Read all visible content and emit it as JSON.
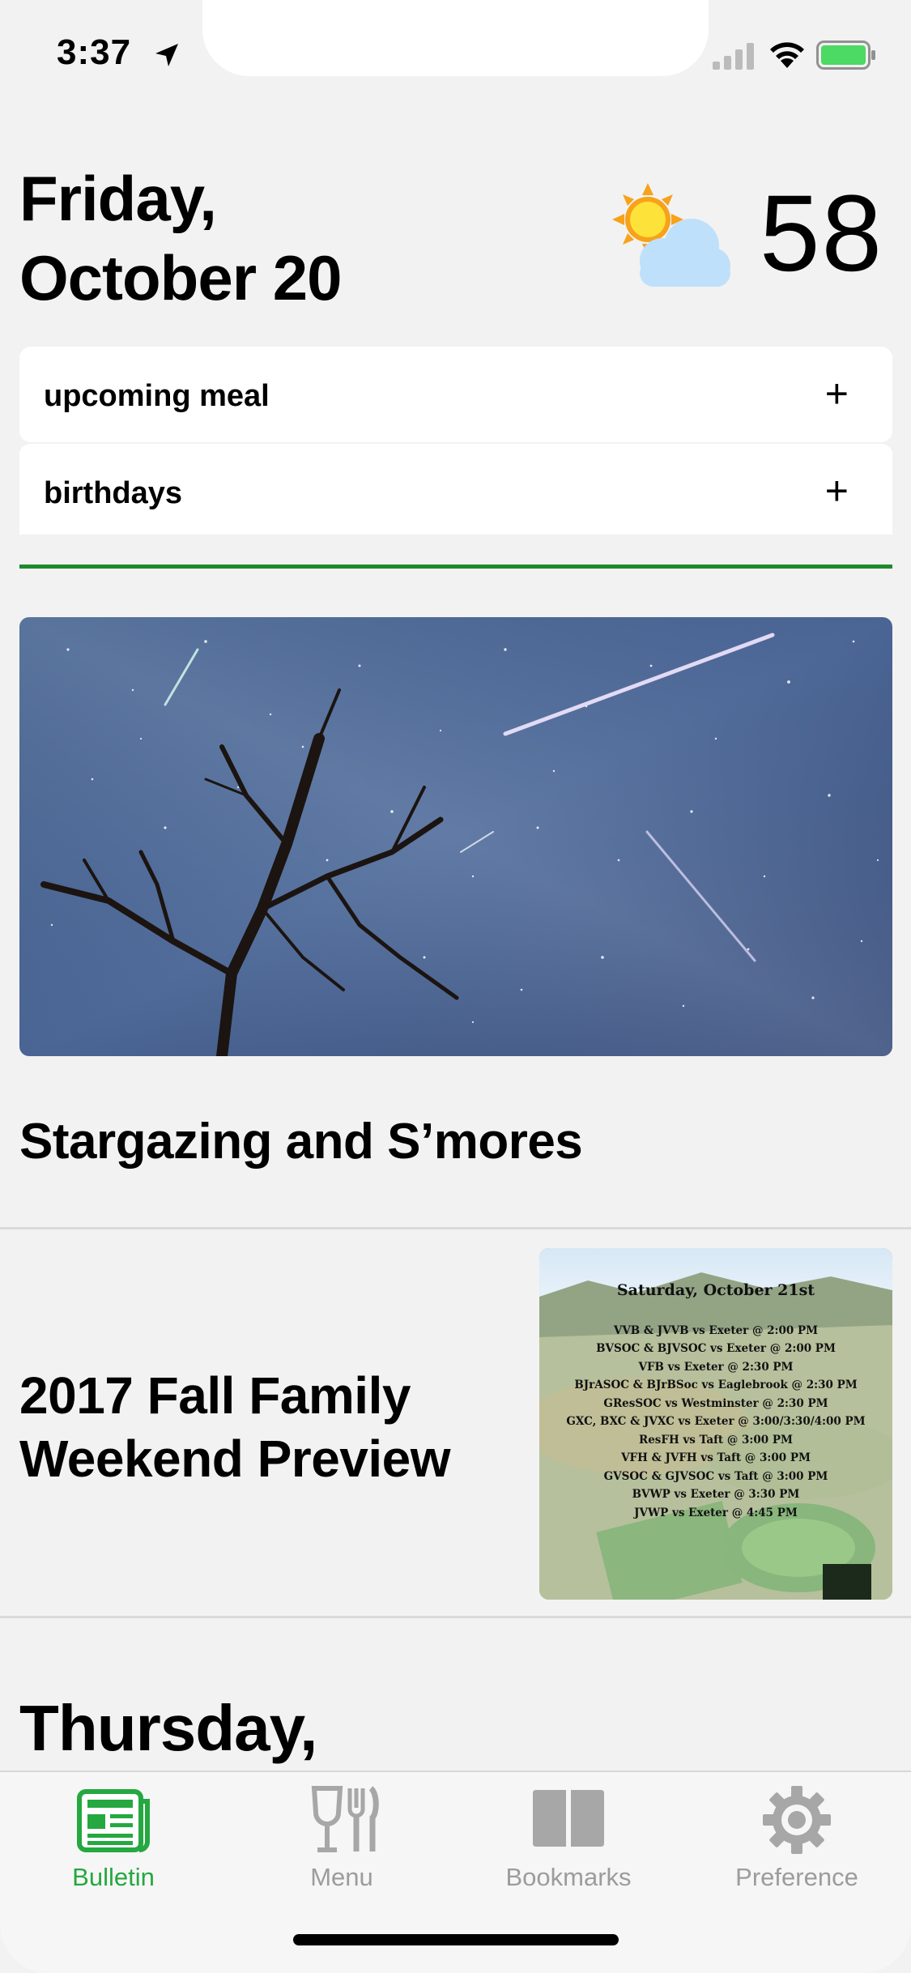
{
  "status_bar": {
    "time": "3:37",
    "battery_color": "#4cd964"
  },
  "header": {
    "date_line1": "Friday,",
    "date_line2": "October 20",
    "weather_icon": "partly-sunny-icon",
    "temperature": "58"
  },
  "accordion": [
    {
      "label": "upcoming meal",
      "toggle": "+"
    },
    {
      "label": "birthdays",
      "toggle": "+"
    }
  ],
  "accent_color": "#1d8a2b",
  "stories": [
    {
      "title": "Stargazing and S’mores",
      "image": "meteor-shower-night-sky-photo"
    },
    {
      "title_line1": "2017 Fall Family",
      "title_line2": "Weekend Preview",
      "image": "campus-aerial-schedule-photo"
    }
  ],
  "schedule_image": {
    "heading": "Saturday, October 21st",
    "lines": [
      "VVB & JVVB  vs Exeter @ 2:00 PM",
      "BVSOC & BJVSOC vs Exeter @ 2:00 PM",
      "VFB vs Exeter @ 2:30 PM",
      "BJrASOC & BJrBSoc vs Eaglebrook @ 2:30 PM",
      "GResSOC vs  Westminster @ 2:30 PM",
      "GXC, BXC & JVXC vs Exeter @ 3:00/3:30/4:00 PM",
      "ResFH vs Taft @ 3:00 PM",
      "VFH & JVFH vs Taft @ 3:00 PM",
      "GVSOC & GJVSOC vs Taft @ 3:00 PM",
      "BVWP vs Exeter @ 3:30 PM",
      "JVWP vs Exeter @ 4:45 PM"
    ]
  },
  "next_section": {
    "date_line1": "Thursday,"
  },
  "tab_bar": {
    "active_color": "#25a840",
    "inactive_color": "#9c9c9c",
    "tabs": [
      {
        "label": "Bulletin",
        "icon": "newspaper-icon",
        "active": true
      },
      {
        "label": "Menu",
        "icon": "fork-knife-glass-icon",
        "active": false
      },
      {
        "label": "Bookmarks",
        "icon": "book-icon",
        "active": false
      },
      {
        "label": "Preference",
        "icon": "gear-icon",
        "active": false
      }
    ]
  }
}
